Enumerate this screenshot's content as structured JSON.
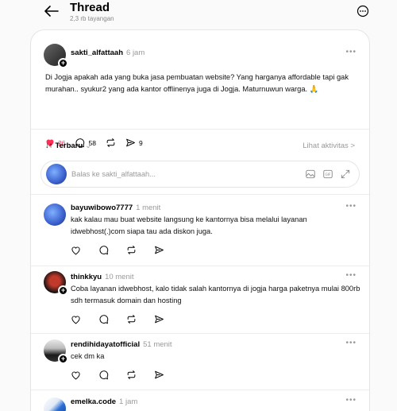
{
  "header": {
    "title": "Thread",
    "subtitle": "2,3 rb tayangan"
  },
  "post": {
    "username": "sakti_alfattaah",
    "time": "6 jam",
    "text": "Di Jogja apakah ada yang buka jasa pembuatan website? Yang harganya affordable tapi gak murahan.. syukur2 yang ada kantor offlinenya juga di Jogja. Maturnuwun warga. 🙏",
    "likes": "26",
    "comments": "58",
    "shares": "9"
  },
  "sort": {
    "label": "Terbaru",
    "activity": "Lihat aktivitas >"
  },
  "reply": {
    "placeholder": "Balas ke sakti_alfattaah..."
  },
  "comments": [
    {
      "username": "bayuwibowo7777",
      "time": "1 menit",
      "text": "kak kalau mau buat website langsung ke kantornya bisa melalui layanan idwebhost(.)com siapa tau ada diskon juga."
    },
    {
      "username": "thinkkyu",
      "time": "10 menit",
      "text": "Coba layanan idwebhost, kalo tidak salah kantornya di jogja harga paketnya mulai 800rb sdh termasuk domain dan hosting"
    },
    {
      "username": "rendihidayatofficial",
      "time": "51 menit",
      "text": "cek dm ka"
    },
    {
      "username": "emelka.code",
      "time": "1 jam",
      "text": ""
    }
  ],
  "colors": {
    "accent_red": "#ff2d55",
    "text_muted": "#999999"
  }
}
